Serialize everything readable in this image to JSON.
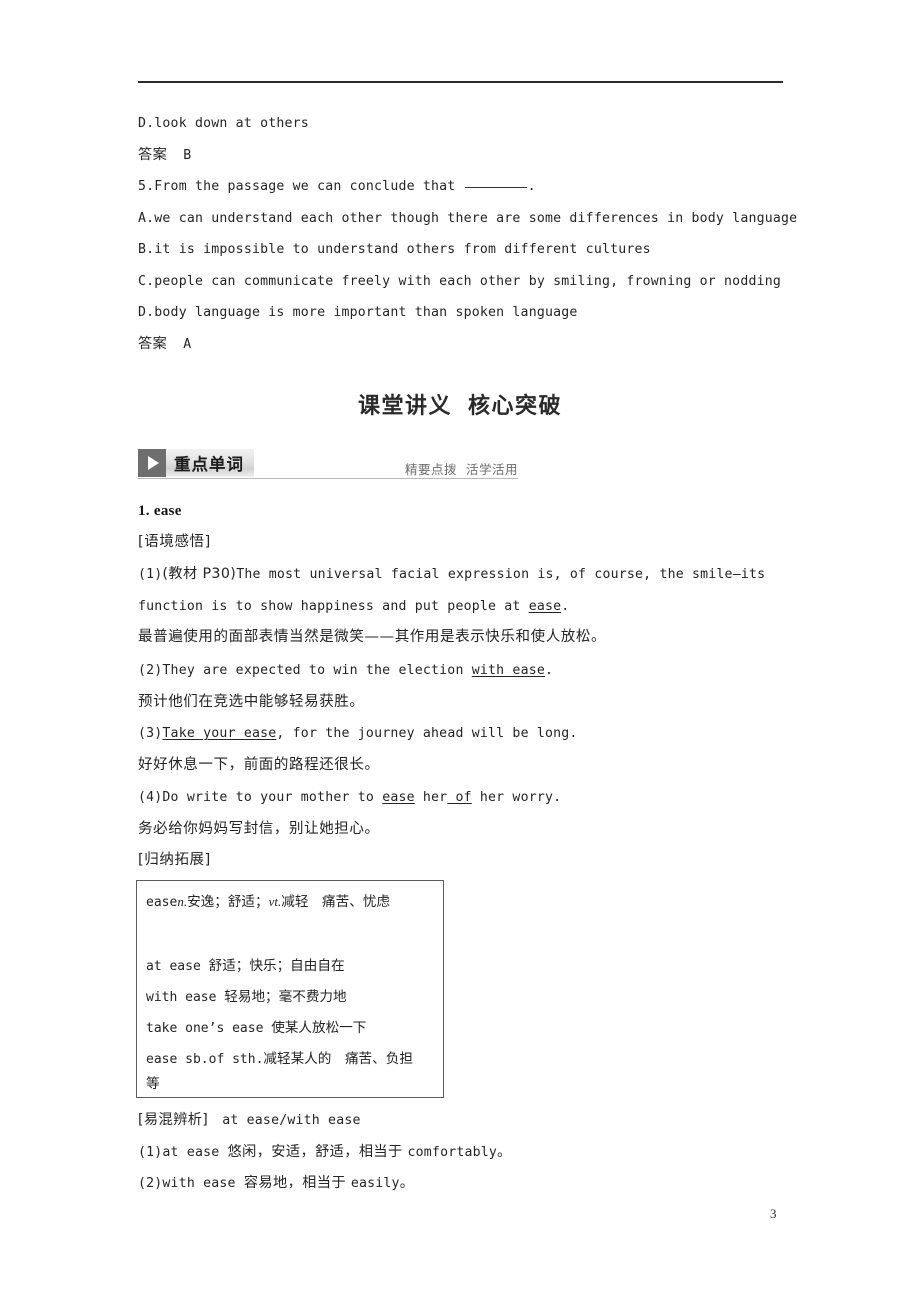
{
  "page": {
    "number": "3"
  },
  "top_questions": [
    {
      "id": "q4-opt-d",
      "kind": "option",
      "text": "D.look down at others"
    },
    {
      "id": "q4-answer",
      "kind": "answer",
      "label": "答案",
      "value": "B"
    },
    {
      "id": "q5-stem",
      "kind": "stem",
      "prefix": "5.From the passage we can conclude that ",
      "blank": true,
      "suffix": "."
    },
    {
      "id": "q5-opt-a",
      "kind": "option",
      "text": "A.we can understand each other though there are some differences in body language"
    },
    {
      "id": "q5-opt-b",
      "kind": "option",
      "text": "B.it is impossible to understand others from different cultures"
    },
    {
      "id": "q5-opt-c",
      "kind": "option",
      "text": "C.people can communicate freely with each other by smiling, frowning or nodding"
    },
    {
      "id": "q5-opt-d",
      "kind": "option",
      "text": "D.body language is more important than spoken language"
    },
    {
      "id": "q5-answer",
      "kind": "answer",
      "label": "答案",
      "value": "A"
    }
  ],
  "section_title": {
    "part1": "课堂讲义",
    "part2": "核心突破"
  },
  "banner": {
    "icon": "play-triangle-icon",
    "label": "重点单词",
    "sub1": "精要点拨",
    "sub2": "活学活用"
  },
  "entry": {
    "head": "1. ease",
    "subhead_context": "[语境感悟]",
    "subhead_extend": "[归纳拓展]",
    "examples": [
      {
        "id": "ex1",
        "en_line1_pre": "(1)",
        "en_line1_cn": "(教材 P30)",
        "en_line1": "The most universal facial expression is, of course, the smile—its",
        "en_line2_pre": "function is to show happiness and put people at ",
        "en_line2_ul": "ease",
        "en_line2_post": ".",
        "zh": "最普遍使用的面部表情当然是微笑——其作用是表示快乐和使人放松。"
      },
      {
        "id": "ex2",
        "en_pre": "(2)They are expected to win the election ",
        "en_ul": "with ease",
        "en_post": ".",
        "zh": "预计他们在竞选中能够轻易获胜。"
      },
      {
        "id": "ex3",
        "en_pre": "(3)",
        "en_ul": "Take your ease",
        "en_post": ", for the journey ahead will be long.",
        "zh": "好好休息一下，前面的路程还很长。"
      },
      {
        "id": "ex4",
        "en_pre": "(4)Do write to your mother to ",
        "en_ul": "ease",
        "en_mid": " her",
        "en_ul2": " of",
        "en_post": " her worry.",
        "zh": "务必给你妈妈写封信，别让她担心。"
      }
    ],
    "summary_box": [
      {
        "id": "sb-1",
        "head": "ease",
        "pos1": "n.",
        "def1": "安逸；舒适；",
        "pos2": "vt.",
        "def2": "减轻　痛苦、忧虑"
      },
      {
        "id": "sb-2",
        "text": "at ease ",
        "zh": "舒适；快乐；自由自在"
      },
      {
        "id": "sb-3",
        "text": "with ease ",
        "zh": "轻易地；毫不费力地"
      },
      {
        "id": "sb-4",
        "text": "take one’s ease ",
        "zh": "使某人放松一下"
      },
      {
        "id": "sb-5",
        "text": "ease sb.of sth.",
        "zh": "减轻某人的　痛苦、负担"
      },
      {
        "id": "sb-6",
        "text": "",
        "zh": "等"
      }
    ],
    "distinguish": {
      "label": "[易混辨析]",
      "pair": "at ease/with ease",
      "items": [
        {
          "id": "dis-1",
          "num": "(1)",
          "term": "at ease ",
          "zh": "悠闲，安适，舒适，相当于 ",
          "eq": "comfortably",
          "end": "。"
        },
        {
          "id": "dis-2",
          "num": "(2)",
          "term": "with ease ",
          "zh": "容易地，相当于 ",
          "eq": "easily",
          "end": "。"
        }
      ]
    }
  }
}
